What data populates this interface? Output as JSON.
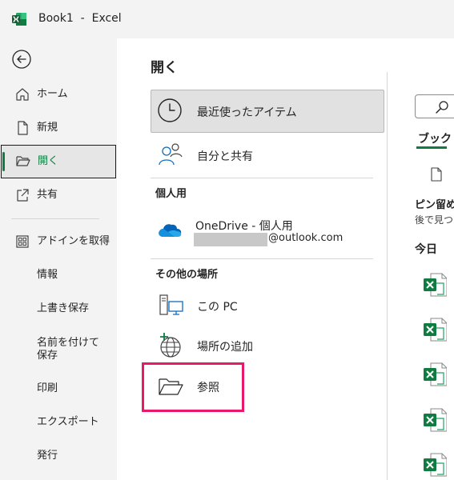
{
  "window": {
    "title": "Book1  -  Excel"
  },
  "nav": {
    "items": [
      {
        "label": "ホーム",
        "icon": "home-icon"
      },
      {
        "label": "新規",
        "icon": "new-document-icon"
      },
      {
        "label": "開く",
        "icon": "folder-open-icon",
        "active": true
      },
      {
        "label": "共有",
        "icon": "share-icon"
      },
      {
        "label": "アドインを取得",
        "icon": "add-ins-icon"
      },
      {
        "label": "情報"
      },
      {
        "label": "上書き保存"
      },
      {
        "label": "名前を付けて保存"
      },
      {
        "label": "印刷"
      },
      {
        "label": "エクスポート"
      },
      {
        "label": "発行"
      }
    ]
  },
  "main": {
    "title": "開く",
    "recent": "最近使ったアイテム",
    "shared": "自分と共有",
    "personal_header": "個人用",
    "onedrive": {
      "name": "OneDrive - 個人用",
      "email": "@outlook.com"
    },
    "other_header": "その他の場所",
    "this_pc": "この PC",
    "add_place": "場所の追加",
    "browse": "参照"
  },
  "right": {
    "tab": "ブック",
    "pinned_title": "ピン留め",
    "pinned_sub": "後で見つけ",
    "today": "今日"
  },
  "colors": {
    "accent": "#107c41",
    "highlight": "#e8186a"
  }
}
